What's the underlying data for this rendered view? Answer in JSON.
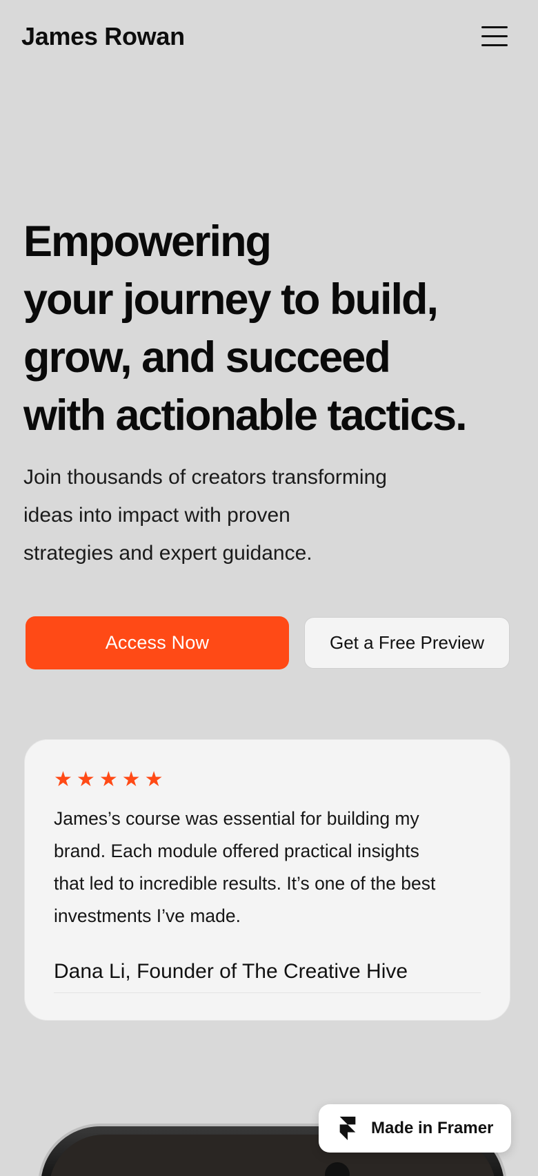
{
  "header": {
    "brand": "James Rowan",
    "menu_icon": "hamburger-menu-icon"
  },
  "hero": {
    "title_lines": [
      "Empowering",
      "your journey to build,",
      "grow, and succeed",
      "with actionable tactics."
    ],
    "subtitle_lines": [
      "Join thousands of creators transforming",
      "ideas into impact with proven",
      "strategies and expert guidance."
    ],
    "primary_cta": "Access Now",
    "secondary_cta": "Get a Free Preview"
  },
  "testimonial": {
    "rating": 5,
    "star_icon": "star-icon",
    "quote_lines": [
      "James’s course was essential for building my",
      "brand. Each module offered practical insights",
      "that led to incredible results. It’s one of the best",
      "investments I’ve made."
    ],
    "author": "Dana Li, Founder of The Creative Hive"
  },
  "badge": {
    "label": "Made in Framer",
    "icon": "framer-logo-icon"
  },
  "colors": {
    "background": "#d9d9d9",
    "accent": "#ff4a16",
    "card": "#f4f4f4",
    "text": "#0d0d0d"
  }
}
